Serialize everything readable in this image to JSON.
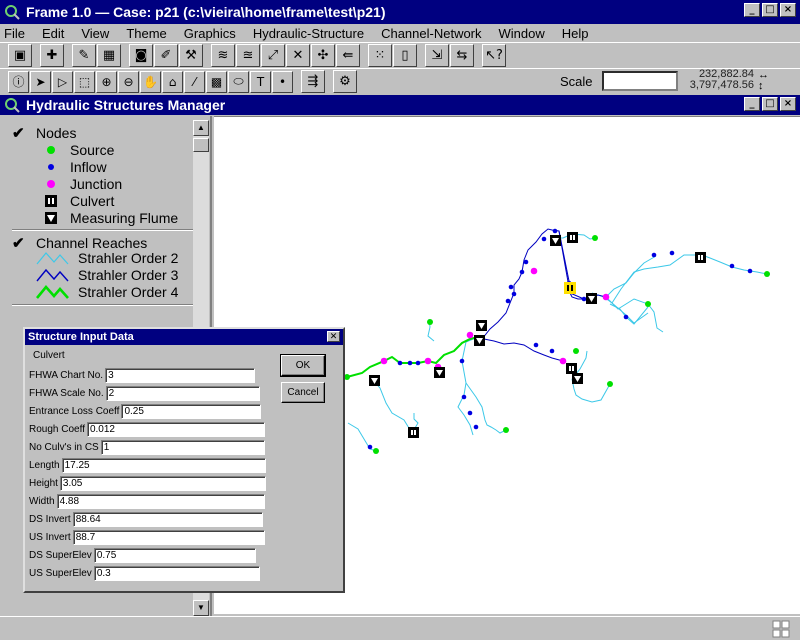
{
  "window": {
    "title": "Frame 1.0  —  Case: p21 (c:\\vieira\\home\\frame\\test\\p21)",
    "buttons": [
      "_",
      "□",
      "×"
    ]
  },
  "menu": [
    "File",
    "Edit",
    "View",
    "Theme",
    "Graphics",
    "Hydraulic-Structure",
    "Channel-Network",
    "Window",
    "Help"
  ],
  "toolbar": {
    "scale_label": "Scale",
    "scale_value": "",
    "coord_x": "232,882.84",
    "coord_y": "3,797,478.56"
  },
  "subwindow": {
    "title": "Hydraulic Structures Manager",
    "buttons": [
      "_",
      "□",
      "×"
    ]
  },
  "legend": {
    "nodes_header": "Nodes",
    "nodes": [
      {
        "label": "Source",
        "color": "#00e000",
        "icon": "green-dot-icon"
      },
      {
        "label": "Inflow",
        "color": "#0000e0",
        "icon": "blue-dot-icon"
      },
      {
        "label": "Junction",
        "color": "#ff00ff",
        "icon": "magenta-dot-icon"
      },
      {
        "label": "Culvert",
        "color": "#000000",
        "icon": "culvert-icon"
      },
      {
        "label": "Measuring Flume",
        "color": "#000000",
        "icon": "flume-icon"
      }
    ],
    "reaches_header": "Channel Reaches",
    "reaches": [
      {
        "label": "Strahler Order 2",
        "color": "#3cc8e8"
      },
      {
        "label": "Strahler Order 3",
        "color": "#0000c0"
      },
      {
        "label": "Strahler Order 4",
        "color": "#00e000"
      }
    ]
  },
  "dialog": {
    "title": "Structure Input Data",
    "type_label": "Culvert",
    "fields": [
      {
        "label": "FHWA Chart No.",
        "value": "3"
      },
      {
        "label": "FHWA Scale No.",
        "value": "2"
      },
      {
        "label": "Entrance Loss Coeff",
        "value": "0.25"
      },
      {
        "label": "Rough Coeff",
        "value": "0.012"
      },
      {
        "label": "No Culv's in CS",
        "value": "1"
      },
      {
        "label": "Length",
        "value": "17.25"
      },
      {
        "label": "Height",
        "value": "3.05"
      },
      {
        "label": "Width",
        "value": "4.88"
      },
      {
        "label": "DS Invert",
        "value": "88.64"
      },
      {
        "label": "US Invert",
        "value": "88.7"
      },
      {
        "label": "DS SuperElev",
        "value": "0.75"
      },
      {
        "label": "US SuperElev",
        "value": "0.3"
      }
    ],
    "ok_label": "OK",
    "cancel_label": "Cancel"
  }
}
